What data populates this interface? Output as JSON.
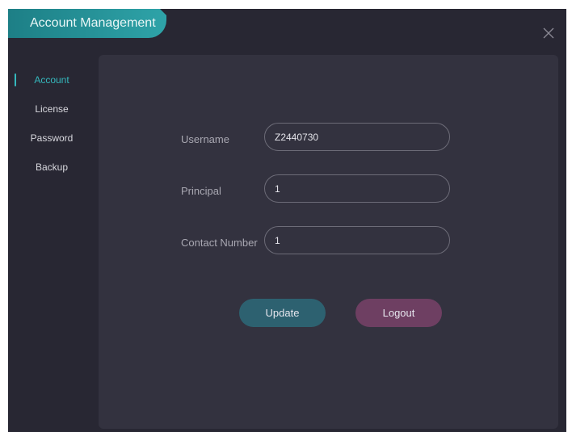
{
  "window": {
    "title": "Account Management"
  },
  "sidebar": {
    "items": [
      {
        "label": "Account",
        "active": true
      },
      {
        "label": "License",
        "active": false
      },
      {
        "label": "Password",
        "active": false
      },
      {
        "label": "Backup",
        "active": false
      }
    ]
  },
  "form": {
    "username": {
      "label": "Username",
      "value": "Z2440730"
    },
    "principal": {
      "label": "Principal",
      "value": "1"
    },
    "contact_number": {
      "label": "Contact Number",
      "value": "1"
    }
  },
  "actions": {
    "update_label": "Update",
    "logout_label": "Logout"
  },
  "colors": {
    "accent": "#35b8bd",
    "window_bg": "#282733",
    "panel_bg": "#33323f",
    "update_button": "#2d6170",
    "logout_button": "#6e3f62"
  },
  "icons": {
    "close": "close-icon"
  }
}
